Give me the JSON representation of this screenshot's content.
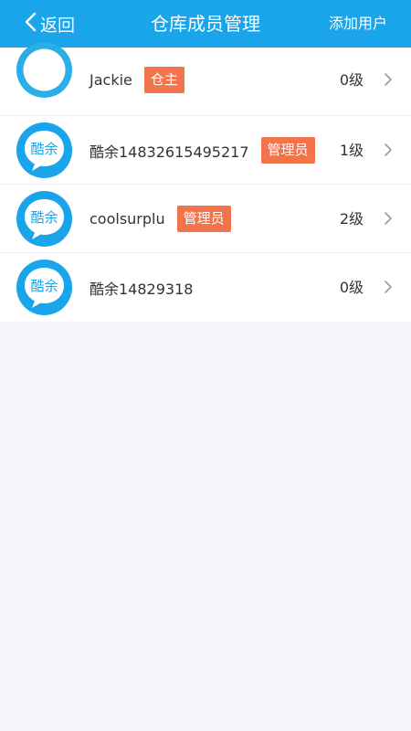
{
  "header": {
    "back_label": "返回",
    "title": "仓库成员管理",
    "add_user_label": "添加用户",
    "background_color": "#1aa4e9"
  },
  "members": [
    {
      "name": "Jackie",
      "role": "仓主",
      "level": "0级",
      "avatar_icon": "default-avatar-icon"
    },
    {
      "name": "酷余14832615495217",
      "role": "管理员",
      "level": "1级",
      "avatar_icon": "kuyu-logo-avatar-icon",
      "avatar_text": "酷余"
    },
    {
      "name": "coolsurplu",
      "role": "管理员",
      "level": "2级",
      "avatar_icon": "kuyu-logo-avatar-icon",
      "avatar_text": "酷余"
    },
    {
      "name": "酷余14829318",
      "role": "",
      "level": "0级",
      "avatar_icon": "kuyu-logo-avatar-icon",
      "avatar_text": "酷余"
    }
  ],
  "colors": {
    "badge": "#f2744c",
    "avatar_blue": "#1aa4e9"
  }
}
